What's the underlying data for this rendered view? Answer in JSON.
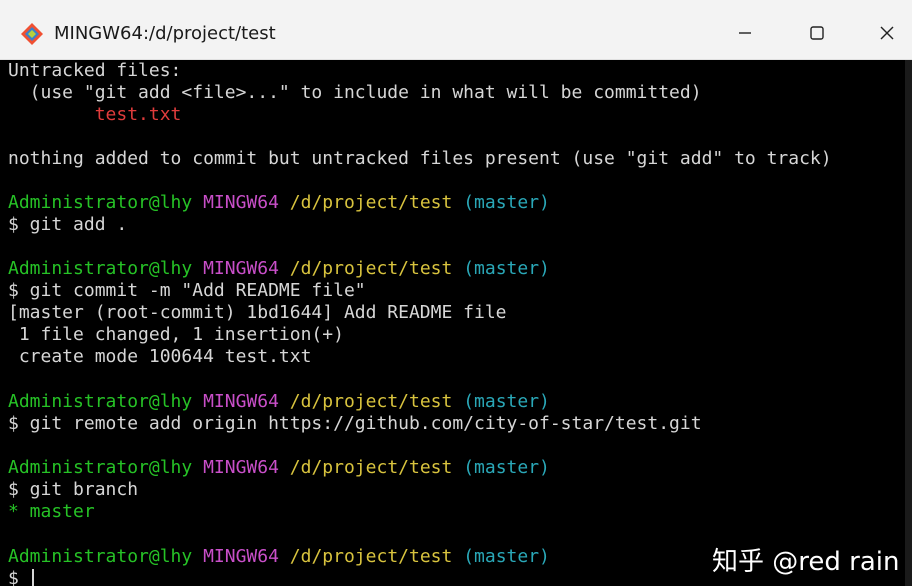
{
  "window": {
    "title": "MINGW64:/d/project/test",
    "app_icon": "git-diamond-icon",
    "controls": [
      "minimize-icon",
      "maximize-icon",
      "close-icon"
    ],
    "minimize_glyph": "—",
    "maximize_glyph": "☐",
    "close_glyph": "✕"
  },
  "terminal": {
    "untracked_header": "Untracked files:",
    "untracked_hint": "  (use \"git add <file>...\" to include in what will be committed)",
    "untracked_file": "        test.txt",
    "nothing_added": "nothing added to commit but untracked files present (use \"git add\" to track)",
    "prompt": {
      "user_host": "Administrator@lhy",
      "system": "MINGW64",
      "path": "/d/project/test",
      "branch": "(master)"
    },
    "cmd_add": "$ git add .",
    "cmd_commit": "$ git commit -m \"Add README file\"",
    "commit_out_1": "[master (root-commit) 1bd1644] Add README file",
    "commit_out_2": " 1 file changed, 1 insertion(+)",
    "commit_out_3": " create mode 100644 test.txt",
    "cmd_remote": "$ git remote add origin https://github.com/city-of-star/test.git",
    "cmd_branch": "$ git branch",
    "branch_out": "* master",
    "current_prompt": "$ "
  },
  "watermark": "知乎 @red rain",
  "colors": {
    "background": "#000000",
    "text": "#d6d6d6",
    "red": "#e03c3c",
    "green": "#26c226",
    "magenta": "#c94fc9",
    "yellow": "#d8c33e",
    "cyan": "#2aa8b8"
  }
}
